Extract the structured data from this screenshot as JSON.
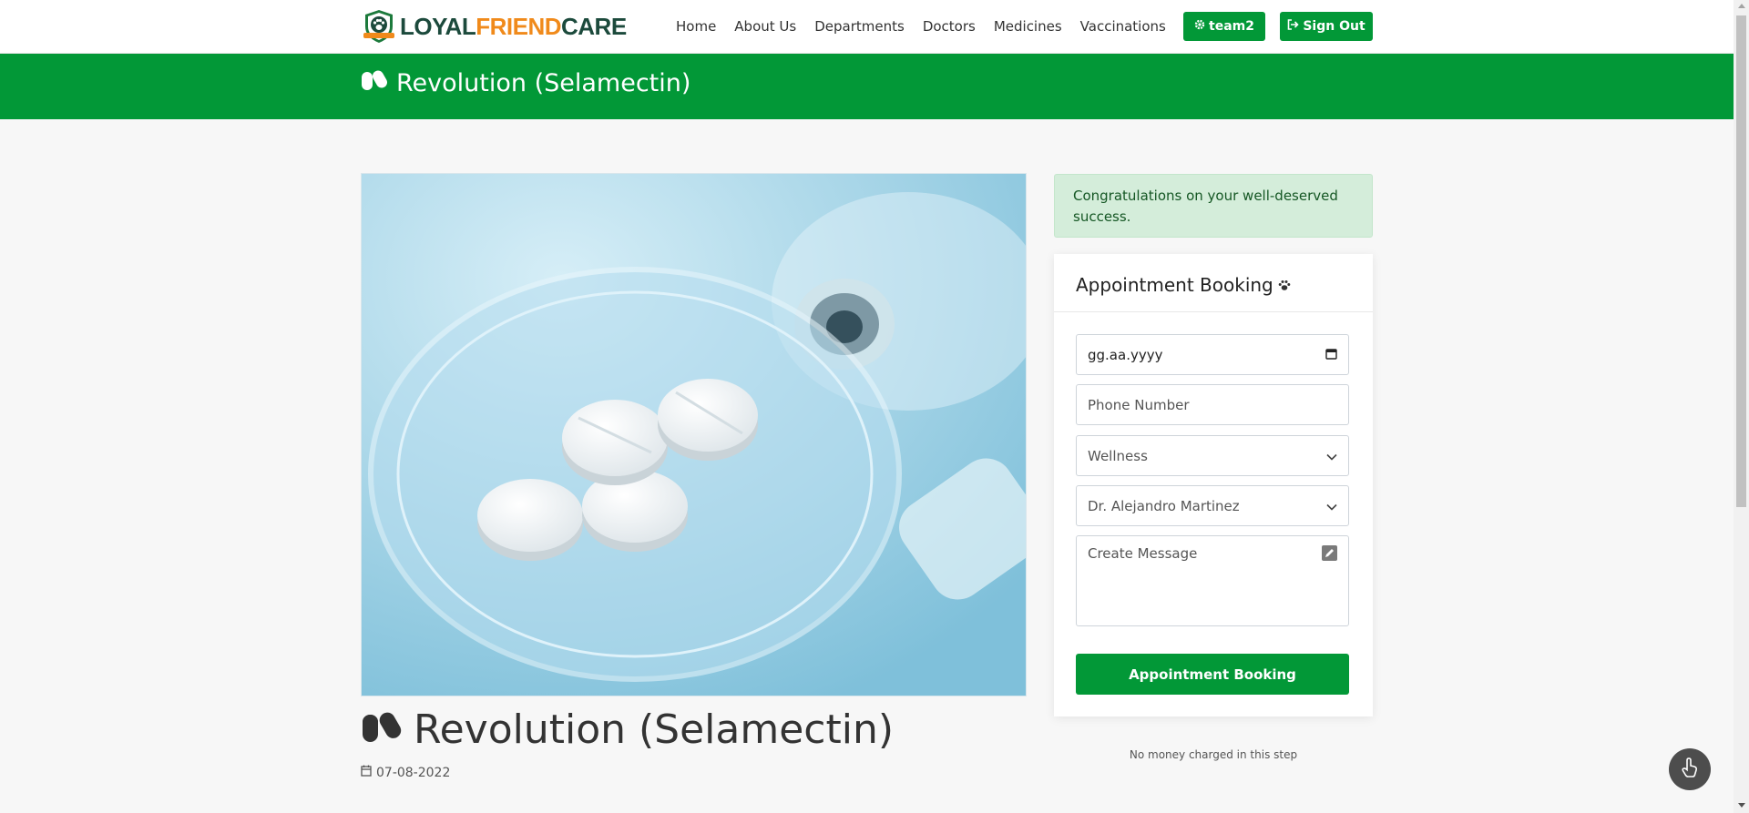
{
  "brand": {
    "part1": "LOYAL",
    "part2": "FRIEND",
    "part3": "CARE"
  },
  "nav": {
    "links": [
      "Home",
      "About Us",
      "Departments",
      "Doctors",
      "Medicines",
      "Vaccinations"
    ],
    "user_label": "team2",
    "signout_label": "Sign Out"
  },
  "banner": {
    "title": "Revolution (Selamectin)"
  },
  "article": {
    "title": "Revolution (Selamectin)",
    "date": "07-08-2022"
  },
  "alert": {
    "text": "Congratulations on your well-deserved success."
  },
  "booking": {
    "title": "Appointment Booking",
    "date_placeholder": "gg.aa.yyyy",
    "phone_placeholder": "Phone Number",
    "department_selected": "Wellness",
    "doctor_selected": "Dr. Alejandro Martinez",
    "message_placeholder": "Create Message",
    "submit_label": "Appointment Booking",
    "note": "No money charged in this step"
  },
  "colors": {
    "primary": "#029837",
    "alert_bg": "#d4edda",
    "alert_text": "#155724"
  },
  "icons": [
    "pills-icon",
    "calendar-icon",
    "paw-icon",
    "gear-icon",
    "sign-out-icon",
    "edit-icon",
    "chevron-down-icon",
    "hand-pointer-icon"
  ]
}
